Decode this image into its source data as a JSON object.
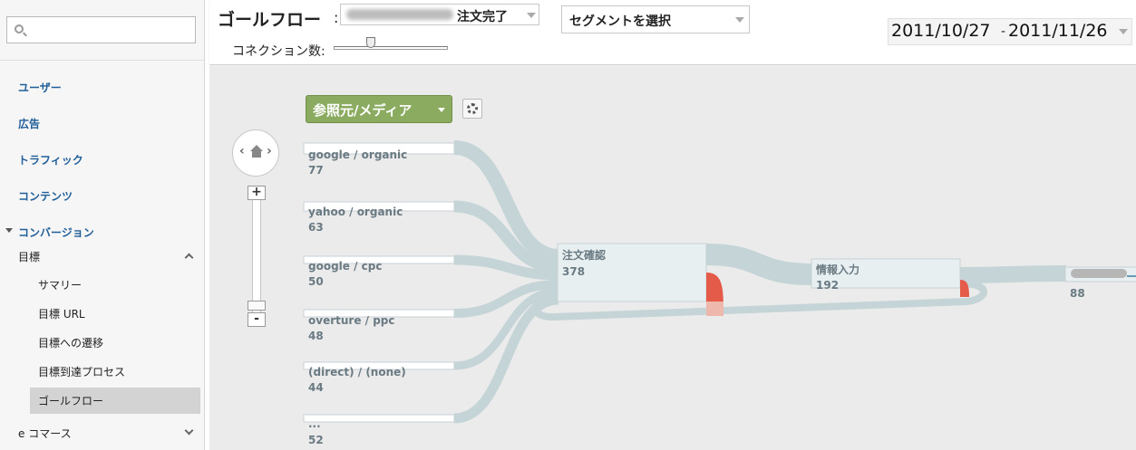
{
  "sidebar": {
    "search_placeholder": "",
    "items": [
      {
        "label": "ユーザー"
      },
      {
        "label": "広告"
      },
      {
        "label": "トラフィック"
      },
      {
        "label": "コンテンツ"
      },
      {
        "label": "コンバージョン"
      }
    ],
    "conversion_sub": {
      "goals_label": "目標",
      "goal_items": [
        "サマリー",
        "目標 URL",
        "目標への遷移",
        "目標到達プロセス",
        "ゴールフロー"
      ],
      "ecommerce_label": "e コマース"
    }
  },
  "header": {
    "title": "ゴールフロー",
    "colon": ":",
    "goal_select_value": "注文完了",
    "segment_select_value": "セグメントを選択",
    "connections_label": "コネクション数:",
    "connections_level": 0.33,
    "date_start": "2011/10/27",
    "date_separator": "-",
    "date_end": "2011/11/26"
  },
  "canvas": {
    "dimension_label": "参照元/メディア",
    "zoom_in": "+",
    "zoom_out": "-",
    "sources": [
      {
        "name": "google / organic",
        "value": "77"
      },
      {
        "name": "yahoo / organic",
        "value": "63"
      },
      {
        "name": "google / cpc",
        "value": "50"
      },
      {
        "name": "overture / ppc",
        "value": "48"
      },
      {
        "name": "(direct) / (none)",
        "value": "44"
      },
      {
        "name": "...",
        "value": "52"
      }
    ],
    "steps": [
      {
        "name": "注文確認",
        "value": "378"
      },
      {
        "name": "情報入力",
        "value": "192"
      },
      {
        "name": "",
        "value": "88"
      }
    ]
  },
  "colors": {
    "flow": "#c5d4d6",
    "node": "#e6eef0",
    "dropoff": "#e55b4a",
    "dimension_button": "#8aab60",
    "nav_link": "#1f5e98"
  }
}
